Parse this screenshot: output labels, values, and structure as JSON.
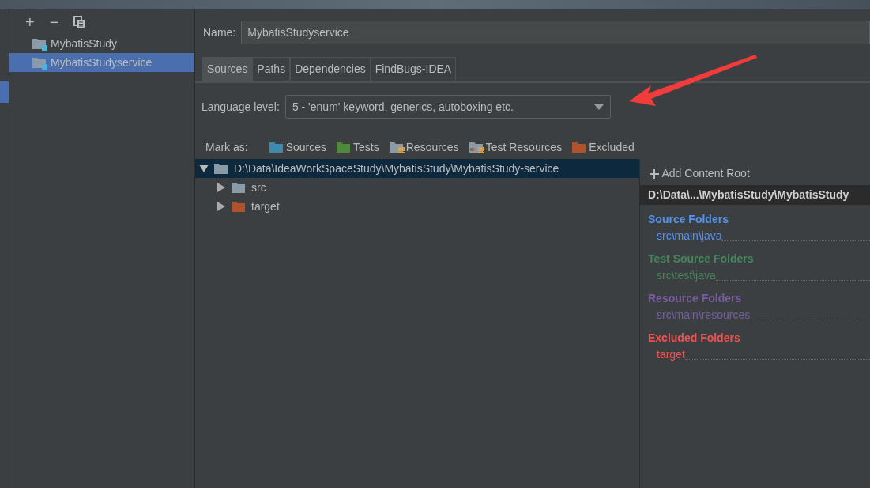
{
  "toolbar": {
    "buttons": [
      {
        "kind": "add",
        "label": "+"
      },
      {
        "kind": "remove",
        "label": "−"
      },
      {
        "kind": "copy"
      }
    ]
  },
  "modules": [
    {
      "name": "MybatisStudy",
      "selected": false
    },
    {
      "name": "MybatisStudyservice",
      "selected": true
    }
  ],
  "name_field": {
    "label": "Name:",
    "value": "MybatisStudyservice"
  },
  "tabs": [
    {
      "label": "Sources",
      "selected": true
    },
    {
      "label": "Paths",
      "selected": false
    },
    {
      "label": "Dependencies",
      "selected": false
    },
    {
      "label": "FindBugs-IDEA",
      "selected": false
    }
  ],
  "language_level": {
    "label": "Language level:",
    "value": "5 - 'enum' keyword, generics, autoboxing etc."
  },
  "mark_as": {
    "label": "Mark as:",
    "items": [
      {
        "kind": "sources",
        "label": "Sources"
      },
      {
        "kind": "tests",
        "label": "Tests"
      },
      {
        "kind": "resources",
        "label": "Resources"
      },
      {
        "kind": "test_resources",
        "label": "Test Resources"
      },
      {
        "kind": "excluded",
        "label": "Excluded"
      }
    ]
  },
  "tree": {
    "label": "D:\\Data\\IdeaWorkSpaceStudy\\MybatisStudy\\MybatisStudy-service",
    "kind": "plain",
    "expanded": true,
    "selected": true,
    "children": [
      {
        "label": "src",
        "kind": "plain",
        "expanded": false,
        "selected": false
      },
      {
        "label": "target",
        "kind": "excluded",
        "expanded": false,
        "selected": false
      }
    ]
  },
  "content_root": {
    "add_label": "Add Content Root",
    "path": "D:\\Data\\...\\MybatisStudy\\MybatisStudy",
    "sections": [
      {
        "title": "Source Folders",
        "color": "#5394ec",
        "items": [
          "src\\main\\java"
        ]
      },
      {
        "title": "Test Source Folders",
        "color": "#44865b",
        "items": [
          "src\\test\\java"
        ]
      },
      {
        "title": "Resource Folders",
        "color": "#785ea0",
        "items": [
          "src\\main\\resources"
        ]
      },
      {
        "title": "Excluded Folders",
        "color": "#ef5350",
        "items": [
          "target"
        ]
      }
    ]
  }
}
